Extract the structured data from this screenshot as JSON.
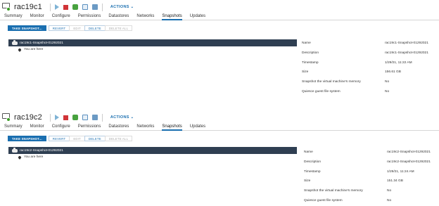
{
  "vms": [
    {
      "name": "rac19c1",
      "actions_label": "ACTIONS ⌄",
      "tabs": [
        "Summary",
        "Monitor",
        "Configure",
        "Permissions",
        "Datastores",
        "Networks",
        "Snapshots",
        "Updates"
      ],
      "active_tab": "Snapshots",
      "buttons": {
        "take_snapshot": "TAKE SNAPSHOT...",
        "revert": "REVERT",
        "edit": "EDIT",
        "delete": "DELETE",
        "delete_all": "DELETE ALL"
      },
      "snapshot_name": "rac19c1-Snapshot-01292021",
      "you_are_here": "You are here",
      "details": [
        {
          "key": "Name",
          "value": "rac19c1-Snapshot-01292021"
        },
        {
          "key": "Description",
          "value": "rac19c1-Snapshot-01292021"
        },
        {
          "key": "Timestamp",
          "value": "1/29/21, 11:22 AM"
        },
        {
          "key": "Size",
          "value": "156.61 GB"
        },
        {
          "key": "Snapshot the virtual machine's memory",
          "value": "No"
        },
        {
          "key": "Quiesce guest file system",
          "value": "No"
        }
      ]
    },
    {
      "name": "rac19c2",
      "actions_label": "ACTIONS ⌄",
      "tabs": [
        "Summary",
        "Monitor",
        "Configure",
        "Permissions",
        "Datastores",
        "Networks",
        "Snapshots",
        "Updates"
      ],
      "active_tab": "Snapshots",
      "buttons": {
        "take_snapshot": "TAKE SNAPSHOT...",
        "revert": "REVERT",
        "edit": "EDIT",
        "delete": "DELETE",
        "delete_all": "DELETE ALL"
      },
      "snapshot_name": "rac19c2-Snapshot-01292021",
      "you_are_here": "You are here",
      "details": [
        {
          "key": "Name",
          "value": "rac19c2-Snapshot-01292021"
        },
        {
          "key": "Description",
          "value": "rac19c2-Snapshot-01292021"
        },
        {
          "key": "Timestamp",
          "value": "1/29/21, 11:24 AM"
        },
        {
          "key": "Size",
          "value": "151.34 GB"
        },
        {
          "key": "Snapshot the virtual machine's memory",
          "value": "No"
        },
        {
          "key": "Quiesce guest file system",
          "value": "No"
        }
      ]
    }
  ],
  "colors": {
    "accent": "#1a6fb0",
    "tree_selected_bg": "#2f3f52",
    "stop_red": "#d13438",
    "green": "#48a23f"
  }
}
